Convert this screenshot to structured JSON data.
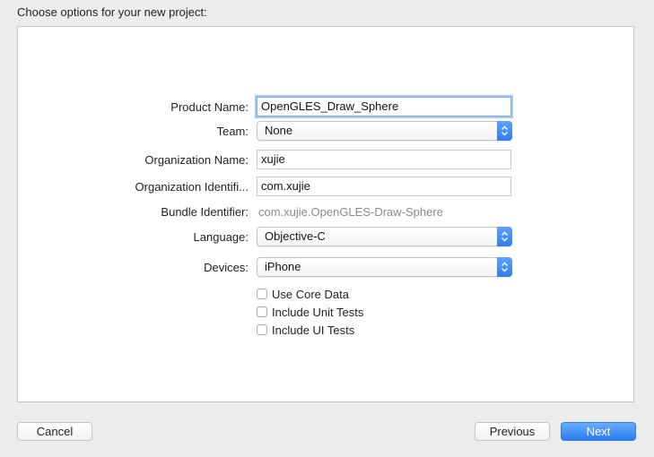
{
  "prompt": "Choose options for your new project:",
  "form": {
    "product_name": {
      "label": "Product Name:",
      "value": "OpenGLES_Draw_Sphere"
    },
    "team": {
      "label": "Team:",
      "value": "None"
    },
    "organization_name": {
      "label": "Organization Name:",
      "value": "xujie"
    },
    "organization_identifier": {
      "label": "Organization Identifi...",
      "value": "com.xujie"
    },
    "bundle_identifier": {
      "label": "Bundle Identifier:",
      "value": "com.xujie.OpenGLES-Draw-Sphere"
    },
    "language": {
      "label": "Language:",
      "value": "Objective-C"
    },
    "devices": {
      "label": "Devices:",
      "value": "iPhone"
    },
    "checkboxes": [
      {
        "label": "Use Core Data",
        "checked": false
      },
      {
        "label": "Include Unit Tests",
        "checked": false
      },
      {
        "label": "Include UI Tests",
        "checked": false
      }
    ]
  },
  "buttons": {
    "cancel": "Cancel",
    "previous": "Previous",
    "next": "Next"
  },
  "colors": {
    "accent": "#2a7cf1",
    "focus_ring": "#a9c8f2",
    "window_bg": "#ececec"
  },
  "icons": {
    "popup_stepper": "up-down-chevron-icon"
  }
}
